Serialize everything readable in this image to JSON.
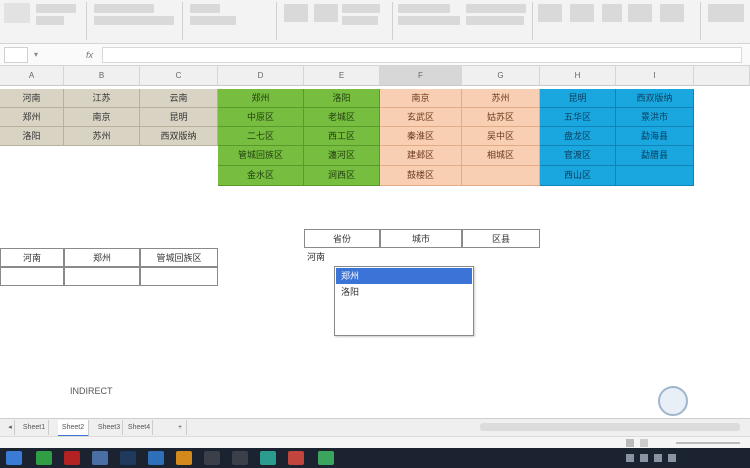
{
  "formula_bar": {
    "name_box": "",
    "fx": "fx",
    "content": ""
  },
  "columns": [
    "A",
    "B",
    "C",
    "D",
    "E",
    "F",
    "G",
    "H",
    "I"
  ],
  "tables": {
    "province": {
      "rows": [
        [
          "河南",
          "江苏",
          "云南"
        ],
        [
          "郑州",
          "南京",
          "昆明"
        ],
        [
          "洛阳",
          "苏州",
          "西双版纳"
        ]
      ]
    },
    "zhengzhou": {
      "rows": [
        [
          "郑州"
        ],
        [
          "中原区"
        ],
        [
          "二七区"
        ],
        [
          "管城回族区"
        ],
        [
          "金水区"
        ]
      ]
    },
    "luoyang": {
      "rows": [
        [
          "洛阳"
        ],
        [
          "老城区"
        ],
        [
          "西工区"
        ],
        [
          "瀍河区"
        ],
        [
          "涧西区"
        ]
      ]
    },
    "nanjing": {
      "rows": [
        [
          "南京"
        ],
        [
          "玄武区"
        ],
        [
          "秦淮区"
        ],
        [
          "建邺区"
        ],
        [
          "鼓楼区"
        ]
      ]
    },
    "suzhou": {
      "rows": [
        [
          "苏州"
        ],
        [
          "姑苏区"
        ],
        [
          "吴中区"
        ],
        [
          "相城区"
        ]
      ]
    },
    "kunming": {
      "rows": [
        [
          "昆明"
        ],
        [
          "五华区"
        ],
        [
          "盘龙区"
        ],
        [
          "官渡区"
        ],
        [
          "西山区"
        ]
      ]
    },
    "xishuang": {
      "rows": [
        [
          "西双版纳"
        ],
        [
          "景洪市"
        ],
        [
          "勐海县"
        ],
        [
          "勐腊县"
        ]
      ]
    }
  },
  "lower_left": {
    "labels": [
      "河南",
      "郑州",
      "管城回族区"
    ]
  },
  "lower_mid": {
    "headers": [
      "省份",
      "城市",
      "区县"
    ],
    "active_value": "河南"
  },
  "dropdown": {
    "options": [
      "郑州",
      "洛阳"
    ],
    "selected": "郑州"
  },
  "overlay_text": "INDIRECT",
  "sheet_tabs": [
    "Sheet1",
    "Sheet2",
    "Sheet3",
    "Sheet4"
  ],
  "active_tab": "Sheet2",
  "clock": {
    "time": "",
    "date": ""
  },
  "colors": {
    "tan": "#d9d3c4",
    "green": "#76bd40",
    "peach": "#f8cfb2",
    "blue": "#1aa7e0",
    "selection": "#3c73d6"
  }
}
